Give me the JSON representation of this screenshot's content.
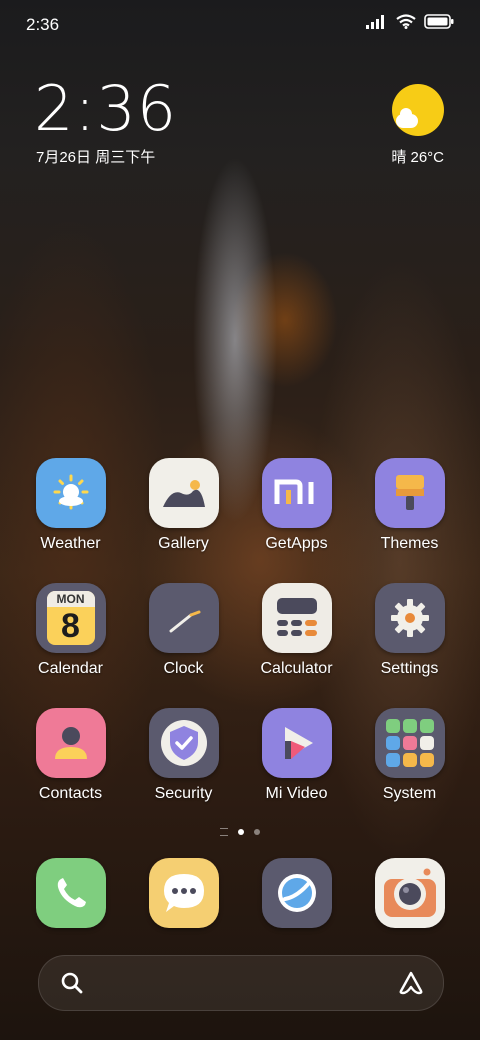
{
  "status_bar": {
    "time": "2:36",
    "icons": [
      "signal-icon",
      "wifi-icon",
      "battery-icon"
    ]
  },
  "clock_widget": {
    "time": "2:36",
    "date": "7月26日 周三下午"
  },
  "weather_widget": {
    "temp": "晴 26°C",
    "icon": "sun-cloud-icon"
  },
  "apps": [
    {
      "label": "Weather",
      "icon": "weather-icon",
      "color": "#5fa8e8"
    },
    {
      "label": "Gallery",
      "icon": "gallery-icon",
      "color": "#f1efe9"
    },
    {
      "label": "GetApps",
      "icon": "getapps-icon",
      "color": "#8f83e0"
    },
    {
      "label": "Themes",
      "icon": "themes-icon",
      "color": "#8f83e0"
    },
    {
      "label": "Calendar",
      "icon": "calendar-icon",
      "color": "#5b5a6e",
      "badge": "MON",
      "day": "8"
    },
    {
      "label": "Clock",
      "icon": "clock-icon",
      "color": "#5b5a6e"
    },
    {
      "label": "Calculator",
      "icon": "calculator-icon",
      "color": "#efece6"
    },
    {
      "label": "Settings",
      "icon": "settings-icon",
      "color": "#5b5a6e"
    },
    {
      "label": "Contacts",
      "icon": "contacts-icon",
      "color": "#ef7a97"
    },
    {
      "label": "Security",
      "icon": "security-icon",
      "color": "#5b5a6e"
    },
    {
      "label": "Mi Video",
      "icon": "mivideo-icon",
      "color": "#8f83e0"
    },
    {
      "label": "System",
      "icon": "system-folder-icon",
      "color": "#5b5a6e"
    }
  ],
  "dock": [
    {
      "icon": "phone-icon",
      "color": "#7fce7f"
    },
    {
      "icon": "messages-icon",
      "color": "#f5cf72"
    },
    {
      "icon": "browser-icon",
      "color": "#5b5a6e"
    },
    {
      "icon": "camera-icon",
      "color": "#f1efe9"
    }
  ],
  "page_indicator": {
    "pages": 2,
    "active": 0
  }
}
